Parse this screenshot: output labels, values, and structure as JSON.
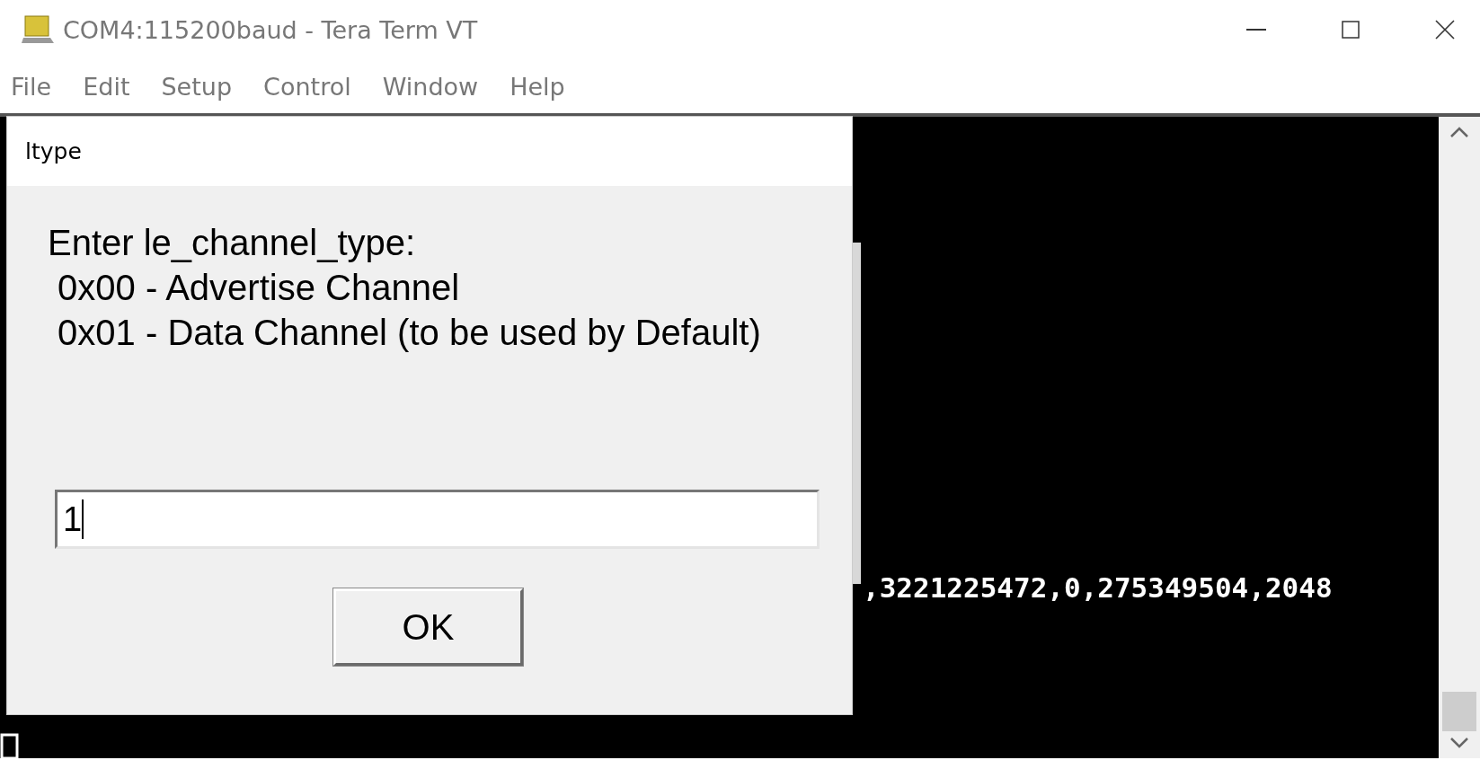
{
  "window": {
    "title": "COM4:115200baud - Tera Term VT"
  },
  "menu": [
    "File",
    "Edit",
    "Setup",
    "Control",
    "Window",
    "Help"
  ],
  "terminal": {
    "lines": [
      ",3221225472,0,275349504,2048"
    ]
  },
  "dialog": {
    "title": "ltype",
    "prompt": [
      "Enter le_channel_type:",
      " 0x00 - Advertise Channel",
      " 0x01 - Data Channel (to be used by Default)"
    ],
    "input": {
      "value": "1",
      "focused": true
    },
    "button": "OK"
  }
}
